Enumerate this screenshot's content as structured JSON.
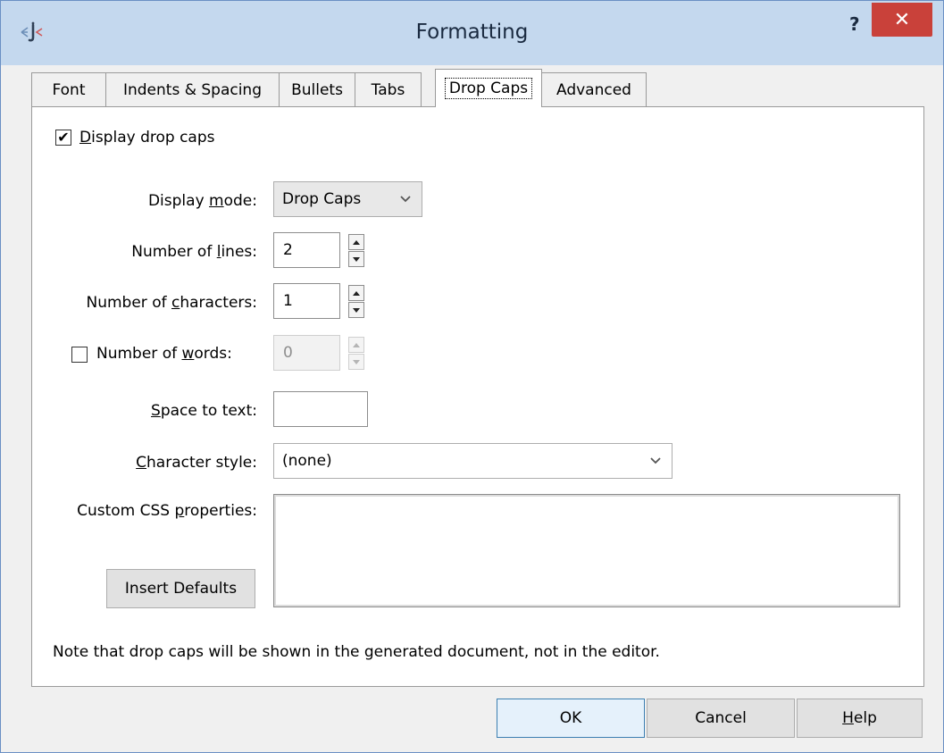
{
  "window": {
    "title": "Formatting",
    "help_glyph": "?",
    "close_glyph": "✕"
  },
  "tabs": [
    {
      "label": "Font"
    },
    {
      "label": "Indents & Spacing"
    },
    {
      "label": "Bullets"
    },
    {
      "label": "Tabs"
    },
    {
      "label": "Drop Caps",
      "active": true
    },
    {
      "label": "Advanced"
    }
  ],
  "drop_caps": {
    "display_checkbox": {
      "checked": true,
      "mnemonic": "D",
      "rest": "isplay drop caps"
    },
    "display_mode": {
      "label_pre": "Display ",
      "label_key": "m",
      "label_post": "ode:",
      "value": "Drop Caps"
    },
    "number_of_lines": {
      "label_pre": "Number of ",
      "label_key": "l",
      "label_post": "ines:",
      "value": "2"
    },
    "number_of_characters": {
      "label_pre": "Number of ",
      "label_key": "c",
      "label_post": "haracters:",
      "value": "1"
    },
    "number_of_words": {
      "checked": false,
      "label_pre": "Number of ",
      "label_key": "w",
      "label_post": "ords:",
      "value": "0"
    },
    "space_to_text": {
      "label_key": "S",
      "label_post": "pace to text:",
      "value": ""
    },
    "character_style": {
      "label_key": "C",
      "label_post": "haracter style:",
      "value": "(none)"
    },
    "custom_css": {
      "label_pre": "Custom CSS ",
      "label_key": "p",
      "label_post": "roperties:",
      "value": ""
    },
    "insert_defaults_label": "Insert Defaults",
    "note": "Note that drop caps will be shown in the generated document, not in the editor."
  },
  "footer": {
    "ok_label": "OK",
    "cancel_label": "Cancel",
    "help_key": "H",
    "help_rest": "elp"
  },
  "icons": {
    "app_icon": "fmt-app-icon",
    "checkmark": "✔"
  },
  "colors": {
    "titlebar": "#c4d8ee",
    "close_button": "#c9413a",
    "default_button_border": "#3c7fb1"
  }
}
